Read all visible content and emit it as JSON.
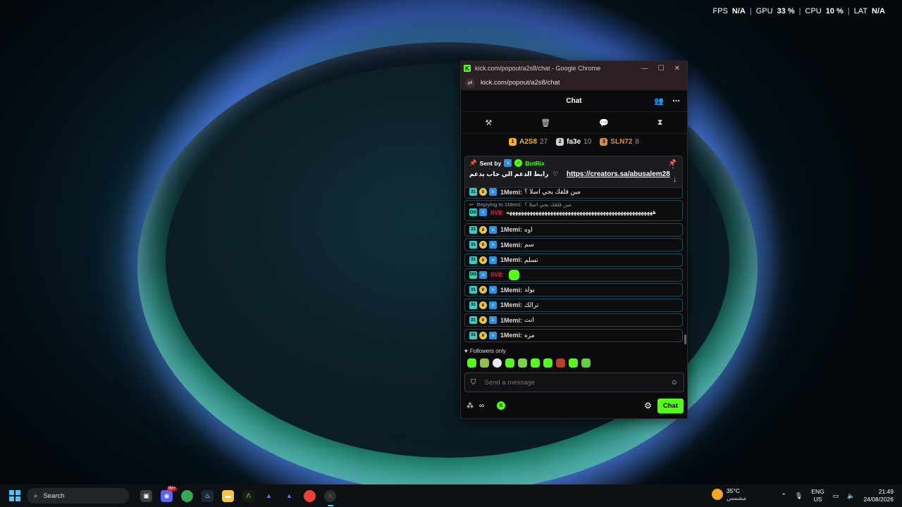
{
  "overlay": {
    "fps_label": "FPS",
    "fps_value": "N/A",
    "gpu_label": "GPU",
    "gpu_value": "33 %",
    "cpu_label": "CPU",
    "cpu_value": "10 %",
    "lat_label": "LAT",
    "lat_value": "N/A"
  },
  "window": {
    "title": "kick.com/popout/a2s8/chat - Google Chrome",
    "url": "kick.com/popout/a2s8/chat"
  },
  "chat": {
    "header": "Chat",
    "leaderboard": [
      {
        "rank": "1",
        "name": "A2S8",
        "count": "27",
        "color": "#f2b22a"
      },
      {
        "rank": "2",
        "name": "fa3e",
        "count": "10",
        "color": "#d0d0d0"
      },
      {
        "rank": "3",
        "name": "SLN72",
        "count": "8",
        "color": "#d98b4a"
      }
    ],
    "pinned": {
      "sent_by": "Sent by",
      "bot": "BotRix",
      "text": "رابط الدعم الي حاب يدعم",
      "link": "https://creators.sa/abusalem28"
    },
    "messages": [
      {
        "type": "msg",
        "user": "1Memi:",
        "text": "مين قلقك بجي اسلا ؟",
        "kind": "memi"
      },
      {
        "type": "reply",
        "reply_label": "Replying to 1Memi:",
        "reply_text": "مين قلقك بجي اسلا ؟",
        "user": "IIVII:",
        "text": "ههههههههههههههههههههههههههههههههههههههههههههههههههه"
      },
      {
        "type": "msg",
        "user": "1Memi:",
        "text": "اوه",
        "kind": "memi"
      },
      {
        "type": "msg",
        "user": "1Memi:",
        "text": "سم",
        "kind": "memi"
      },
      {
        "type": "msg",
        "user": "1Memi:",
        "text": "تسلم",
        "kind": "memi"
      },
      {
        "type": "msg",
        "user": "IIVII:",
        "text": "",
        "kind": "ivii_emote"
      },
      {
        "type": "msg",
        "user": "1Memi:",
        "text": "يولد",
        "kind": "memi"
      },
      {
        "type": "msg",
        "user": "1Memi:",
        "text": "ترالك",
        "kind": "memi"
      },
      {
        "type": "msg",
        "user": "1Memi:",
        "text": "انت",
        "kind": "memi"
      },
      {
        "type": "msg",
        "user": "1Memi:",
        "text": "مره",
        "kind": "memi"
      }
    ],
    "followers_only": "Followers only",
    "input_placeholder": "Send a message",
    "send_label": "Chat",
    "infinity": "∞"
  },
  "taskbar": {
    "search_placeholder": "Search",
    "discord_badge": "99+",
    "weather_temp": "35°C",
    "weather_desc": "مشمس",
    "lang_top": "ENG",
    "lang_bottom": "US",
    "time": "21:49",
    "date": "24/08/2026"
  }
}
